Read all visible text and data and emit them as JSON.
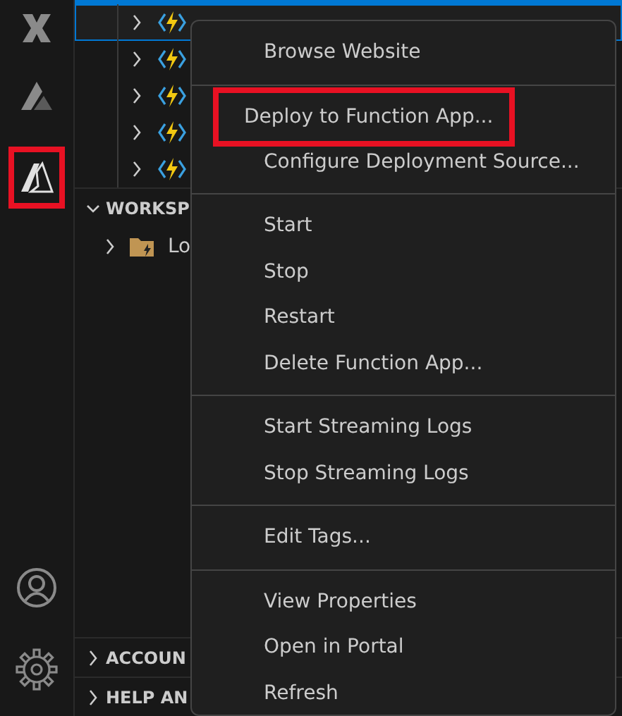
{
  "activity_bar": {
    "top": [
      {
        "kind": "x-logo",
        "highlighted": false
      },
      {
        "kind": "a-logo",
        "highlighted": false
      },
      {
        "kind": "azure",
        "highlighted": true
      }
    ],
    "bottom": [
      {
        "kind": "account"
      },
      {
        "kind": "settings"
      }
    ]
  },
  "tree_rows": [
    {
      "selected": true
    },
    {
      "selected": false
    },
    {
      "selected": false
    },
    {
      "selected": false
    },
    {
      "selected": false
    }
  ],
  "sections": [
    {
      "title": "WORKSP",
      "expanded": true,
      "children": [
        {
          "label": "Lo",
          "expanded": false
        }
      ]
    }
  ],
  "bottom_sections": [
    {
      "title": "ACCOUN",
      "expanded": false
    },
    {
      "title": "HELP AN",
      "expanded": false
    }
  ],
  "context_menu": {
    "groups": [
      [
        {
          "label": "Browse Website",
          "highlighted": false
        }
      ],
      [
        {
          "label": "Deploy to Function App...",
          "highlighted": true
        },
        {
          "label": "Configure Deployment Source...",
          "highlighted": false
        }
      ],
      [
        {
          "label": "Start",
          "highlighted": false
        },
        {
          "label": "Stop",
          "highlighted": false
        },
        {
          "label": "Restart",
          "highlighted": false
        },
        {
          "label": "Delete Function App...",
          "highlighted": false
        }
      ],
      [
        {
          "label": "Start Streaming Logs",
          "highlighted": false
        },
        {
          "label": "Stop Streaming Logs",
          "highlighted": false
        }
      ],
      [
        {
          "label": "Edit Tags...",
          "highlighted": false
        }
      ],
      [
        {
          "label": "View Properties",
          "highlighted": false
        },
        {
          "label": "Open in Portal",
          "highlighted": false
        },
        {
          "label": "Refresh",
          "highlighted": false
        }
      ]
    ]
  }
}
